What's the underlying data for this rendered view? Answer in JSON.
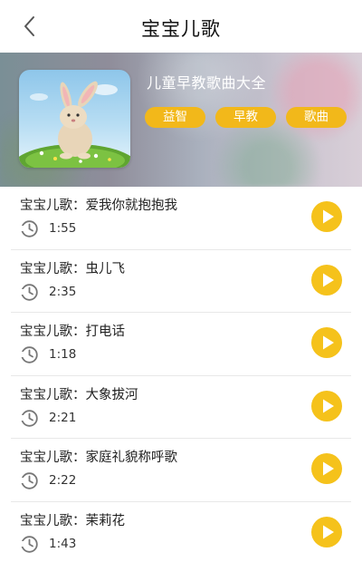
{
  "header": {
    "title": "宝宝儿歌",
    "back_icon": "chevron-left-icon"
  },
  "album": {
    "title": "儿童早教歌曲大全",
    "tags": [
      "益智",
      "早教",
      "歌曲"
    ],
    "accent_color": "#f2b81a"
  },
  "songs": [
    {
      "title": "宝宝儿歌：爱我你就抱抱我",
      "duration": "1:55"
    },
    {
      "title": "宝宝儿歌：虫儿飞",
      "duration": "2:35"
    },
    {
      "title": "宝宝儿歌：打电话",
      "duration": "1:18"
    },
    {
      "title": "宝宝儿歌：大象拔河",
      "duration": "2:21"
    },
    {
      "title": "宝宝儿歌：家庭礼貌称呼歌",
      "duration": "2:22"
    },
    {
      "title": "宝宝儿歌：茉莉花",
      "duration": "1:43"
    }
  ]
}
